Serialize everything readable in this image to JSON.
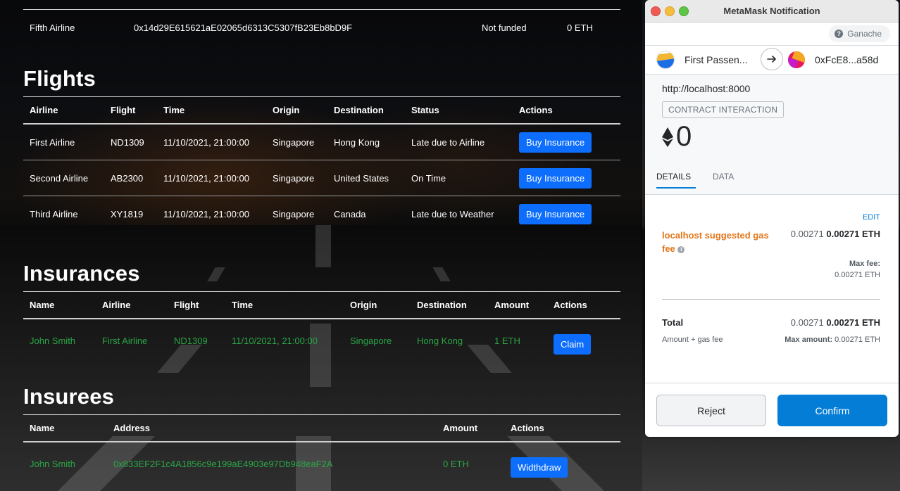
{
  "dapp": {
    "airlines_tail": {
      "name": "Fifth Airline",
      "address": "0x14d29E615621aE02065d6313C5307fB23Eb8bD9F",
      "status": "Not funded",
      "funds": "0 ETH"
    },
    "flights": {
      "title": "Flights",
      "headers": [
        "Airline",
        "Flight",
        "Time",
        "Origin",
        "Destination",
        "Status",
        "Actions"
      ],
      "rows": [
        {
          "airline": "First Airline",
          "flight": "ND1309",
          "time": "11/10/2021, 21:00:00",
          "origin": "Singapore",
          "destination": "Hong Kong",
          "status": "Late due to Airline",
          "action": "Buy Insurance"
        },
        {
          "airline": "Second Airline",
          "flight": "AB2300",
          "time": "11/10/2021, 21:00:00",
          "origin": "Singapore",
          "destination": "United States",
          "status": "On Time",
          "action": "Buy Insurance"
        },
        {
          "airline": "Third Airline",
          "flight": "XY1819",
          "time": "11/10/2021, 21:00:00",
          "origin": "Singapore",
          "destination": "Canada",
          "status": "Late due to Weather",
          "action": "Buy Insurance"
        }
      ]
    },
    "insurances": {
      "title": "Insurances",
      "headers": [
        "Name",
        "Airline",
        "Flight",
        "Time",
        "Origin",
        "Destination",
        "Amount",
        "Actions"
      ],
      "rows": [
        {
          "name": "John Smith",
          "airline": "First Airline",
          "flight": "ND1309",
          "time": "11/10/2021, 21:00:00",
          "origin": "Singapore",
          "destination": "Hong Kong",
          "amount": "1 ETH",
          "action": "Claim"
        }
      ]
    },
    "insurees": {
      "title": "Insurees",
      "headers": [
        "Name",
        "Address",
        "Amount",
        "Actions"
      ],
      "rows": [
        {
          "name": "John Smith",
          "address": "0x833EF2F1c4A1856c9e199aE4903e97Db948eaF2A",
          "amount": "0 ETH",
          "action": "Widthdraw"
        }
      ]
    }
  },
  "metamask": {
    "window_title": "MetaMask Notification",
    "network": "Ganache",
    "from_account": "First Passen...",
    "to_account": "0xFcE8...a58d",
    "origin": "http://localhost:8000",
    "badge": "CONTRACT INTERACTION",
    "amount": "0",
    "tabs": [
      "DETAILS",
      "DATA"
    ],
    "edit": "EDIT",
    "gas_label": "localhost suggested gas fee",
    "gas_secondary": "0.00271",
    "gas_primary": "0.00271 ETH",
    "max_fee_label": "Max fee:",
    "max_fee_value": "0.00271 ETH",
    "total_label": "Total",
    "total_secondary": "0.00271",
    "total_primary": "0.00271 ETH",
    "total_sub": "Amount + gas fee",
    "max_amount_label": "Max amount:",
    "max_amount_value": "0.00271 ETH",
    "reject": "Reject",
    "confirm": "Confirm",
    "accent": "#037dd6",
    "warning": "#e2761b"
  }
}
